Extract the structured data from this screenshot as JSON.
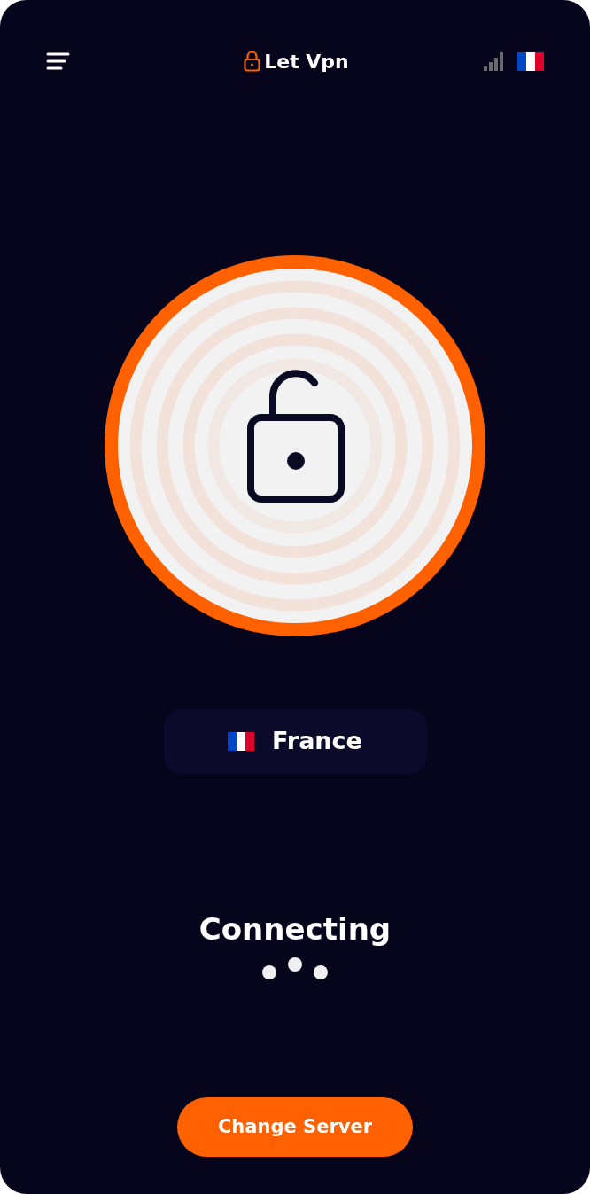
{
  "app": {
    "title": "Let Vpn"
  },
  "location": {
    "country": "France"
  },
  "status": {
    "text": "Connecting"
  },
  "action_button": {
    "label": "Change Server"
  }
}
